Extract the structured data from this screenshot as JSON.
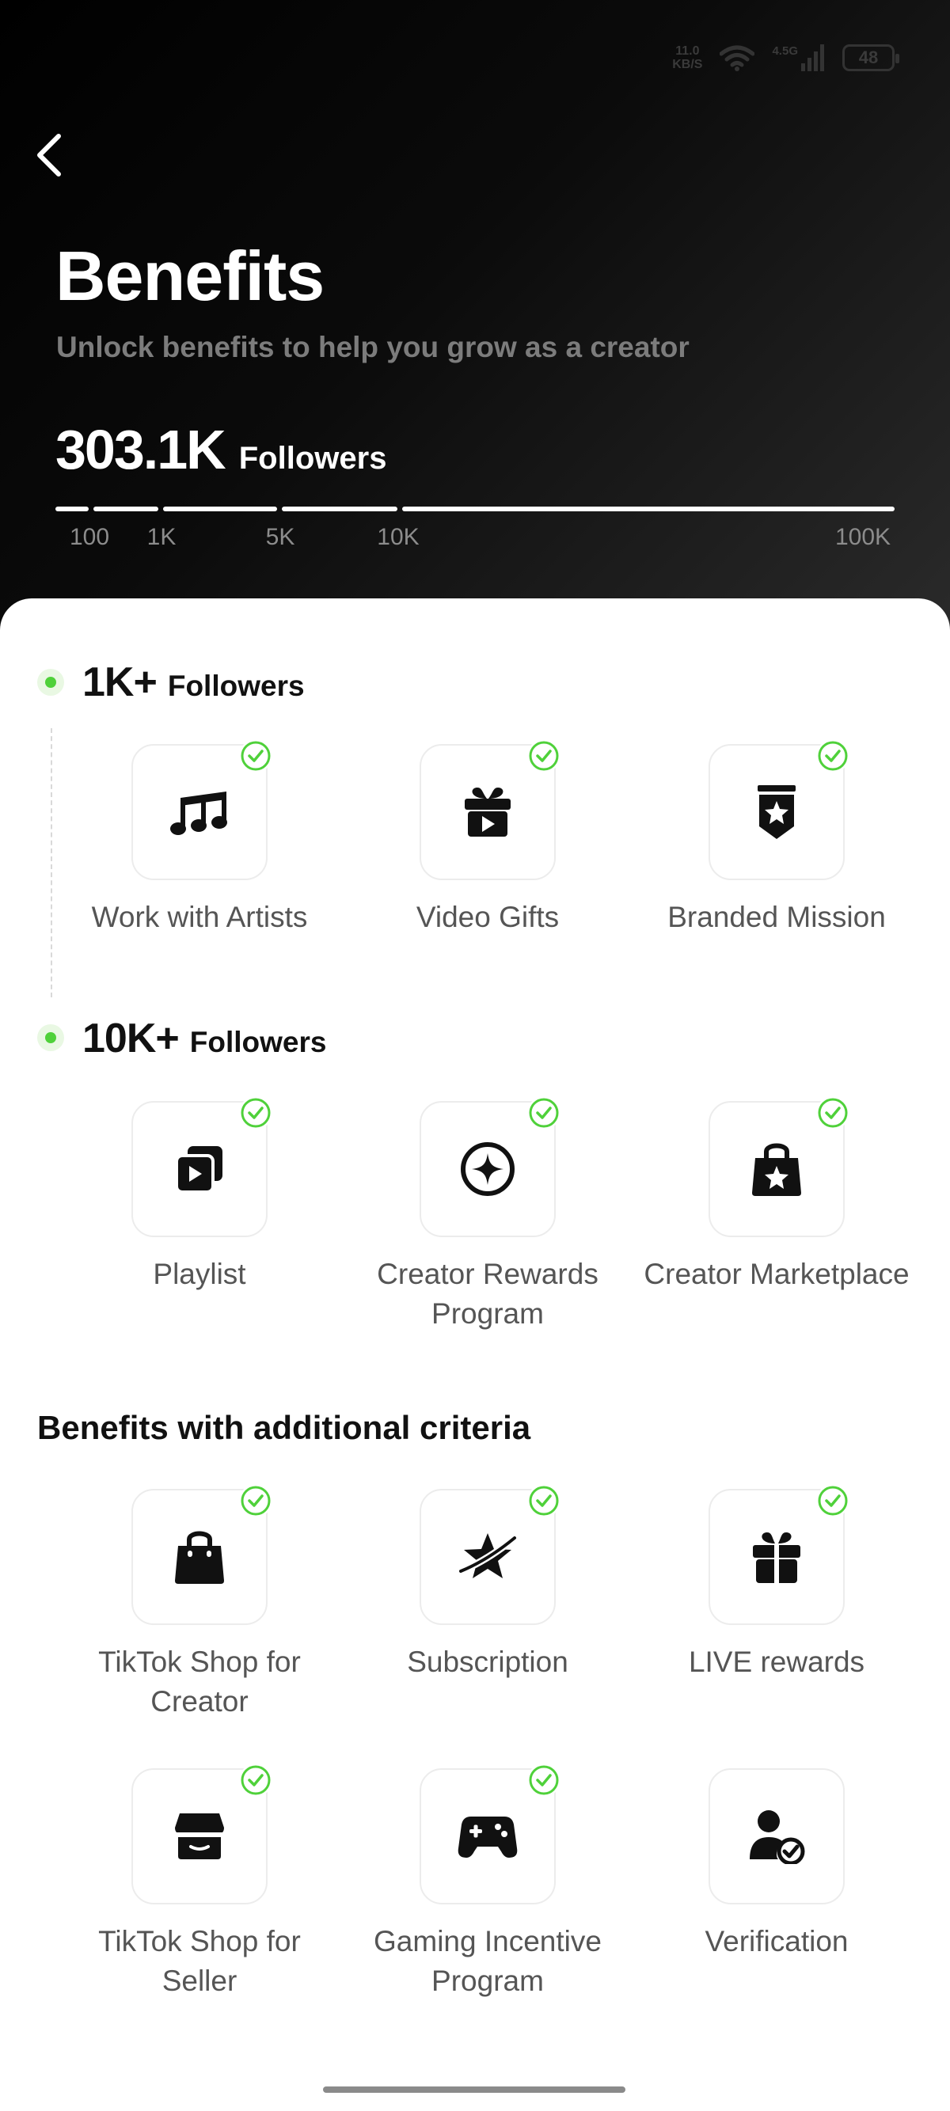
{
  "status_bar": {
    "net_speed": "11.0",
    "net_unit": "KB/S",
    "signal_label": "4.5G",
    "battery": "48"
  },
  "header": {
    "title": "Benefits",
    "subtitle": "Unlock benefits to help you grow as a creator",
    "follower_count": "303.1K",
    "follower_unit": "Followers",
    "progress_ticks": [
      "100",
      "1K",
      "5K",
      "10K",
      "100K"
    ]
  },
  "tiers": [
    {
      "threshold": "1K+",
      "unit": "Followers",
      "benefits": [
        {
          "label": "Work with Artists",
          "icon": "music-notes-icon",
          "unlocked": true
        },
        {
          "label": "Video Gifts",
          "icon": "gift-play-icon",
          "unlocked": true
        },
        {
          "label": "Branded Mission",
          "icon": "ribbon-star-icon",
          "unlocked": true
        }
      ]
    },
    {
      "threshold": "10K+",
      "unit": "Followers",
      "benefits": [
        {
          "label": "Playlist",
          "icon": "playlist-icon",
          "unlocked": true
        },
        {
          "label": "Creator Rewards Program",
          "icon": "star-circle-icon",
          "unlocked": true
        },
        {
          "label": "Creator Marketplace",
          "icon": "shopping-bag-star-icon",
          "unlocked": true
        }
      ]
    }
  ],
  "additional": {
    "title": "Benefits with additional criteria",
    "benefits": [
      {
        "label": "TikTok Shop for Creator",
        "icon": "shopping-bag-icon",
        "unlocked": true
      },
      {
        "label": "Subscription",
        "icon": "star-orbit-icon",
        "unlocked": true
      },
      {
        "label": "LIVE rewards",
        "icon": "gift-icon",
        "unlocked": true
      },
      {
        "label": "TikTok Shop for Seller",
        "icon": "storefront-icon",
        "unlocked": true
      },
      {
        "label": "Gaming Incentive Program",
        "icon": "gamepad-icon",
        "unlocked": true
      },
      {
        "label": "Verification",
        "icon": "user-check-icon",
        "unlocked": false
      }
    ]
  },
  "colors": {
    "accent_green": "#4fd13a",
    "hero_bg": "#000000",
    "label_gray": "#555555"
  }
}
